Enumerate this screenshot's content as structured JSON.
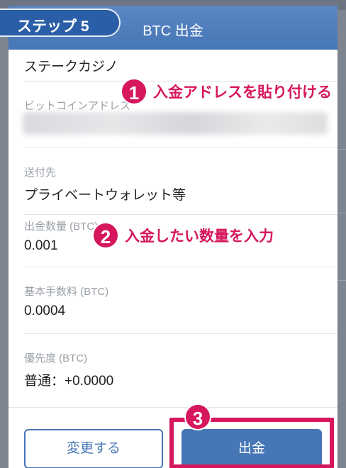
{
  "header": {
    "step_label": "ステップ 5",
    "title": "BTC 出金"
  },
  "fields": {
    "exchange_value": "ステークカジノ",
    "address_label": "ビットコインアドレス",
    "destination_label": "送付先",
    "destination_value": "プライベートウォレット等",
    "amount_label": "出金数量 (BTC)",
    "amount_value": "0.001",
    "fee_label": "基本手数料 (BTC)",
    "fee_value": "0.0004",
    "priority_label": "優先度 (BTC)",
    "priority_value": "普通：+0.0000"
  },
  "annotations": {
    "a1_num": "1",
    "a1_text": "入金アドレスを貼り付ける",
    "a2_num": "2",
    "a2_text": "入金したい数量を入力",
    "a3_num": "3"
  },
  "buttons": {
    "change_label": "変更する",
    "withdraw_label": "出金"
  },
  "colors": {
    "accent_blue": "#4676b6",
    "annotation_pink": "#d6175d"
  }
}
